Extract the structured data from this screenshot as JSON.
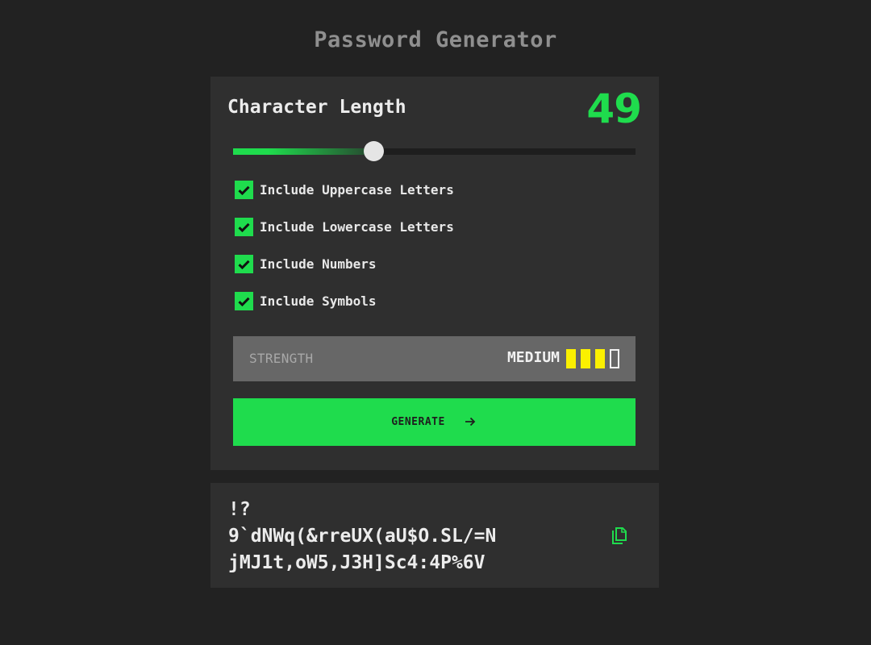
{
  "app": {
    "title": "Password Generator"
  },
  "settings": {
    "length_label": "Character Length",
    "length_value": "49",
    "slider": {
      "value": 49,
      "accent": "#1fdc4d"
    },
    "options": [
      {
        "label": "Include Uppercase Letters",
        "checked": true
      },
      {
        "label": "Include Lowercase Letters",
        "checked": true
      },
      {
        "label": "Include Numbers",
        "checked": true
      },
      {
        "label": "Include Symbols",
        "checked": true
      }
    ],
    "strength": {
      "label": "STRENGTH",
      "level": "MEDIUM",
      "bars_filled": 3,
      "bars_total": 4,
      "bar_color": "#fbf000"
    },
    "generate_label": "GENERATE",
    "generate_icon": "arrow-right-icon"
  },
  "output": {
    "password_lines": [
      "!?",
      "9`dNWq(&rreUX(aU$O.SL/=N",
      "jMJ1t,oW5,J3H]Sc4:4P%6V"
    ],
    "copy_icon": "copy-icon"
  },
  "colors": {
    "background": "#222222",
    "card": "#2f2f2f",
    "accent": "#1fdc4d",
    "strength_panel": "#676767"
  }
}
